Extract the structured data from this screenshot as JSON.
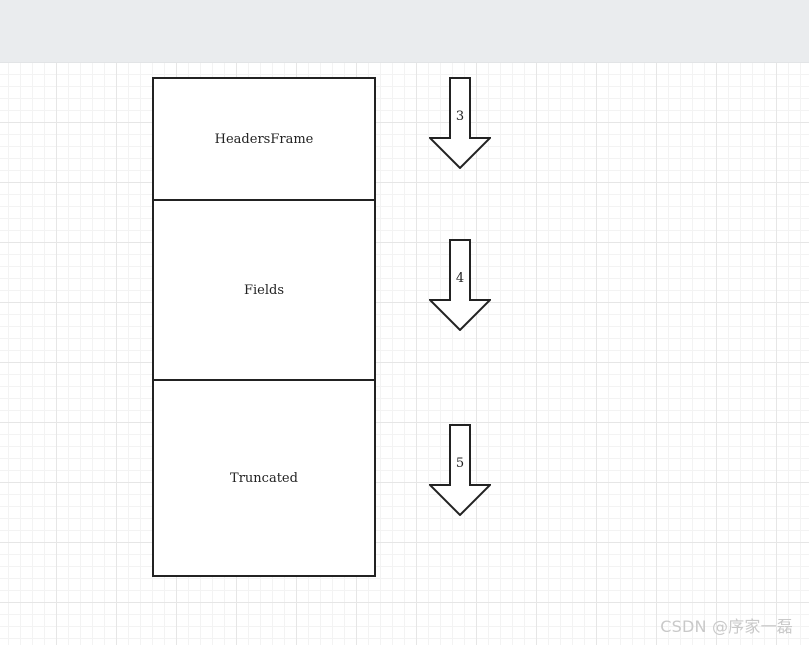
{
  "blocks": [
    {
      "label": "HeadersFrame"
    },
    {
      "label": "Fields"
    },
    {
      "label": "Truncated"
    }
  ],
  "arrows": [
    {
      "label": "3"
    },
    {
      "label": "4"
    },
    {
      "label": "5"
    }
  ],
  "watermark": "CSDN @序家一磊",
  "colors": {
    "stroke": "#222222",
    "toolbar": "#eaecee",
    "grid": "#e6e6e6"
  }
}
